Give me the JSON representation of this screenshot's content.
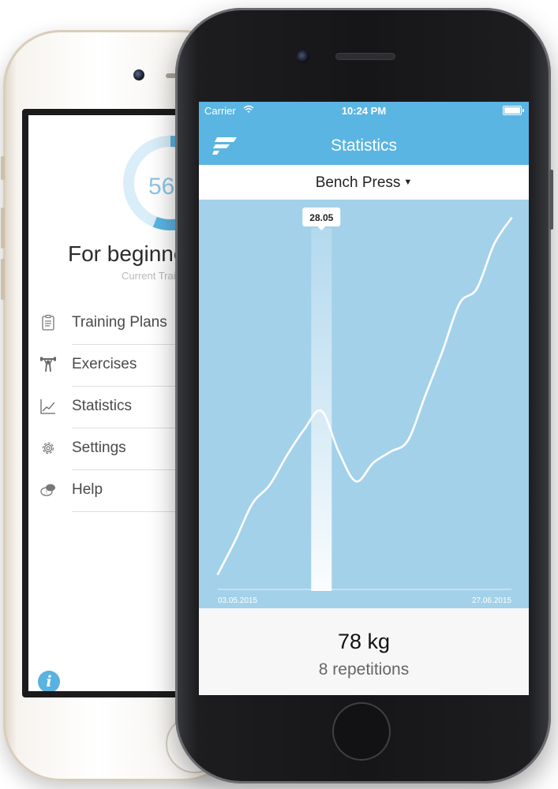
{
  "back_phone": {
    "progress": {
      "value_text": "56",
      "fraction": 0.56
    },
    "plan": {
      "title": "For beginners",
      "subtitle": "Current Training Plan"
    },
    "menu": [
      {
        "label": "Training Plans",
        "icon": "clipboard-icon"
      },
      {
        "label": "Exercises",
        "icon": "weightlifter-icon"
      },
      {
        "label": "Statistics",
        "icon": "line-chart-icon"
      },
      {
        "label": "Settings",
        "icon": "gear-icon"
      },
      {
        "label": "Help",
        "icon": "help-bubble-icon"
      }
    ],
    "info_label": "i"
  },
  "front_phone": {
    "status_bar": {
      "carrier": "Carrier",
      "time": "10:24 PM"
    },
    "nav": {
      "title": "Statistics"
    },
    "selector": {
      "exercise": "Bench Press",
      "caret": "▼"
    },
    "summary": {
      "weight": "78 kg",
      "reps": "8 repetitions"
    }
  },
  "chart_data": {
    "type": "line",
    "x_labels": [
      "03.05.2015",
      "27.06.2015"
    ],
    "selected_index": 6,
    "selected_label": "28.05",
    "points": [
      {
        "i": 0,
        "y": 2
      },
      {
        "i": 1,
        "y": 11
      },
      {
        "i": 2,
        "y": 21
      },
      {
        "i": 3,
        "y": 26
      },
      {
        "i": 4,
        "y": 34
      },
      {
        "i": 5,
        "y": 41
      },
      {
        "i": 6,
        "y": 46
      },
      {
        "i": 7,
        "y": 35
      },
      {
        "i": 8,
        "y": 27
      },
      {
        "i": 9,
        "y": 32
      },
      {
        "i": 10,
        "y": 35
      },
      {
        "i": 11,
        "y": 38
      },
      {
        "i": 12,
        "y": 50
      },
      {
        "i": 13,
        "y": 62
      },
      {
        "i": 14,
        "y": 75
      },
      {
        "i": 15,
        "y": 79
      },
      {
        "i": 16,
        "y": 91
      },
      {
        "i": 17,
        "y": 98
      }
    ],
    "ylim": [
      0,
      100
    ],
    "colors": {
      "background": "#a3d1ea",
      "line": "#ffffff",
      "accent": "#5bb5e2"
    }
  }
}
